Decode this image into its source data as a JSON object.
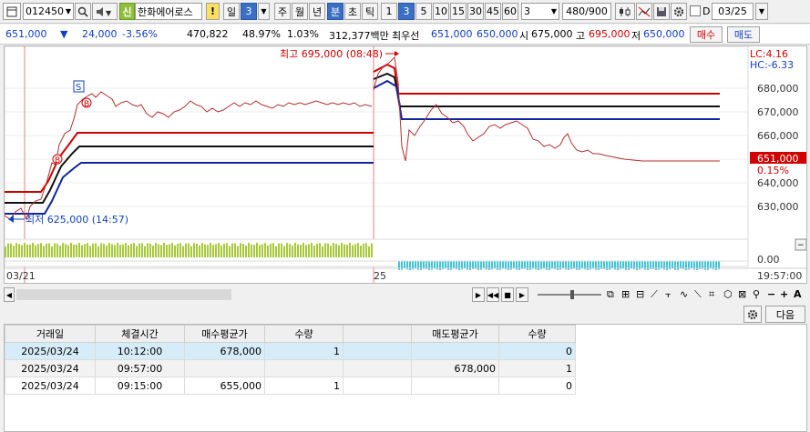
{
  "toolbar": {
    "code": "012450",
    "name": "한화에어로스",
    "credit_badge": "신",
    "warn_badge": "!",
    "period_labels": [
      "일",
      "주",
      "월",
      "년",
      "분",
      "초",
      "틱"
    ],
    "day_value": "3",
    "minute_buttons": [
      "1",
      "3",
      "5",
      "10",
      "15",
      "30",
      "45",
      "60"
    ],
    "custom_value": "3",
    "count": "480/900",
    "date": "03/25",
    "d_label": "D"
  },
  "quote": {
    "price": "651,000",
    "arrow": "▼",
    "change": "24,000",
    "change_pct": "-3.56%",
    "volume": "470,822",
    "vol_ratio": "48.97%",
    "turnover": "1.03%",
    "amount": "312,377백만",
    "best_label": "최우선",
    "best_ask": "651,000",
    "best_bid": "650,000",
    "open_label": "시",
    "open": "675,000",
    "high_label": "고",
    "high": "695,000",
    "low_label": "저",
    "low": "650,000",
    "buy_button": "매수",
    "sell_button": "매도"
  },
  "chart": {
    "high_annot": "최고 695,000 (08:48)",
    "low_annot": "최저 625,000 (14:57)",
    "lc_label": "LC:4.16",
    "hc_label": "HC:-6.33",
    "y_ticks": [
      "680,000",
      "670,000",
      "660,000",
      "650,000",
      "640,000",
      "630,000"
    ],
    "current_price": "651,000",
    "current_pct": "0.15%",
    "vol_tick": "0.00",
    "x_labels": [
      "03/21",
      "25"
    ],
    "time_label": "19:57:00",
    "marker_s": "S",
    "marker_b": "B"
  },
  "grid": {
    "next_button": "다음",
    "headers": [
      "거래일",
      "체결시간",
      "매수평균가",
      "수량",
      "",
      "매도평균가",
      "수량"
    ],
    "rows": [
      [
        "2025/03/24",
        "10:12:00",
        "678,000",
        "1",
        "",
        "",
        "0"
      ],
      [
        "2025/03/24",
        "09:57:00",
        "",
        "",
        "",
        "678,000",
        "1"
      ],
      [
        "2025/03/24",
        "09:15:00",
        "655,000",
        "1",
        "",
        "",
        "0"
      ]
    ]
  },
  "colors": {
    "up": "#d00000",
    "down": "#1040c0",
    "accent": "#3a6fc4",
    "selected_row": "#d6ecf8"
  }
}
